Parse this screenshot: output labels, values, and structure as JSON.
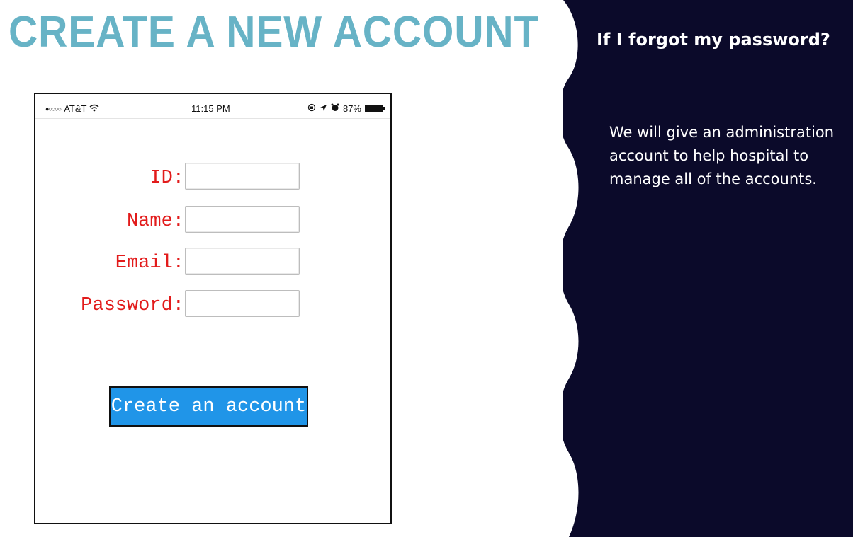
{
  "slide": {
    "title": "CREATE A NEW ACCOUNT"
  },
  "phone": {
    "status_bar": {
      "signal": "●○○○○",
      "carrier": "AT&T",
      "wifi_icon": "wifi-icon",
      "time": "11:15 PM",
      "icons": [
        "orientation-lock-icon",
        "location-arrow-icon",
        "alarm-icon"
      ],
      "battery_percent": "87%",
      "battery_level": 0.87
    },
    "form": {
      "fields": [
        {
          "label": "ID:",
          "value": ""
        },
        {
          "label": "Name:",
          "value": ""
        },
        {
          "label": "Email:",
          "value": ""
        },
        {
          "label": "Password:",
          "value": ""
        }
      ],
      "submit_label": "Create an account"
    }
  },
  "sidebar": {
    "question": "If I forgot my password?",
    "answer": "We will give an administration account to help hospital to manage all of the accounts."
  },
  "colors": {
    "title": "#67b3c6",
    "label": "#e21b1b",
    "button": "#2095e8",
    "panel": "#0b0a2a"
  }
}
